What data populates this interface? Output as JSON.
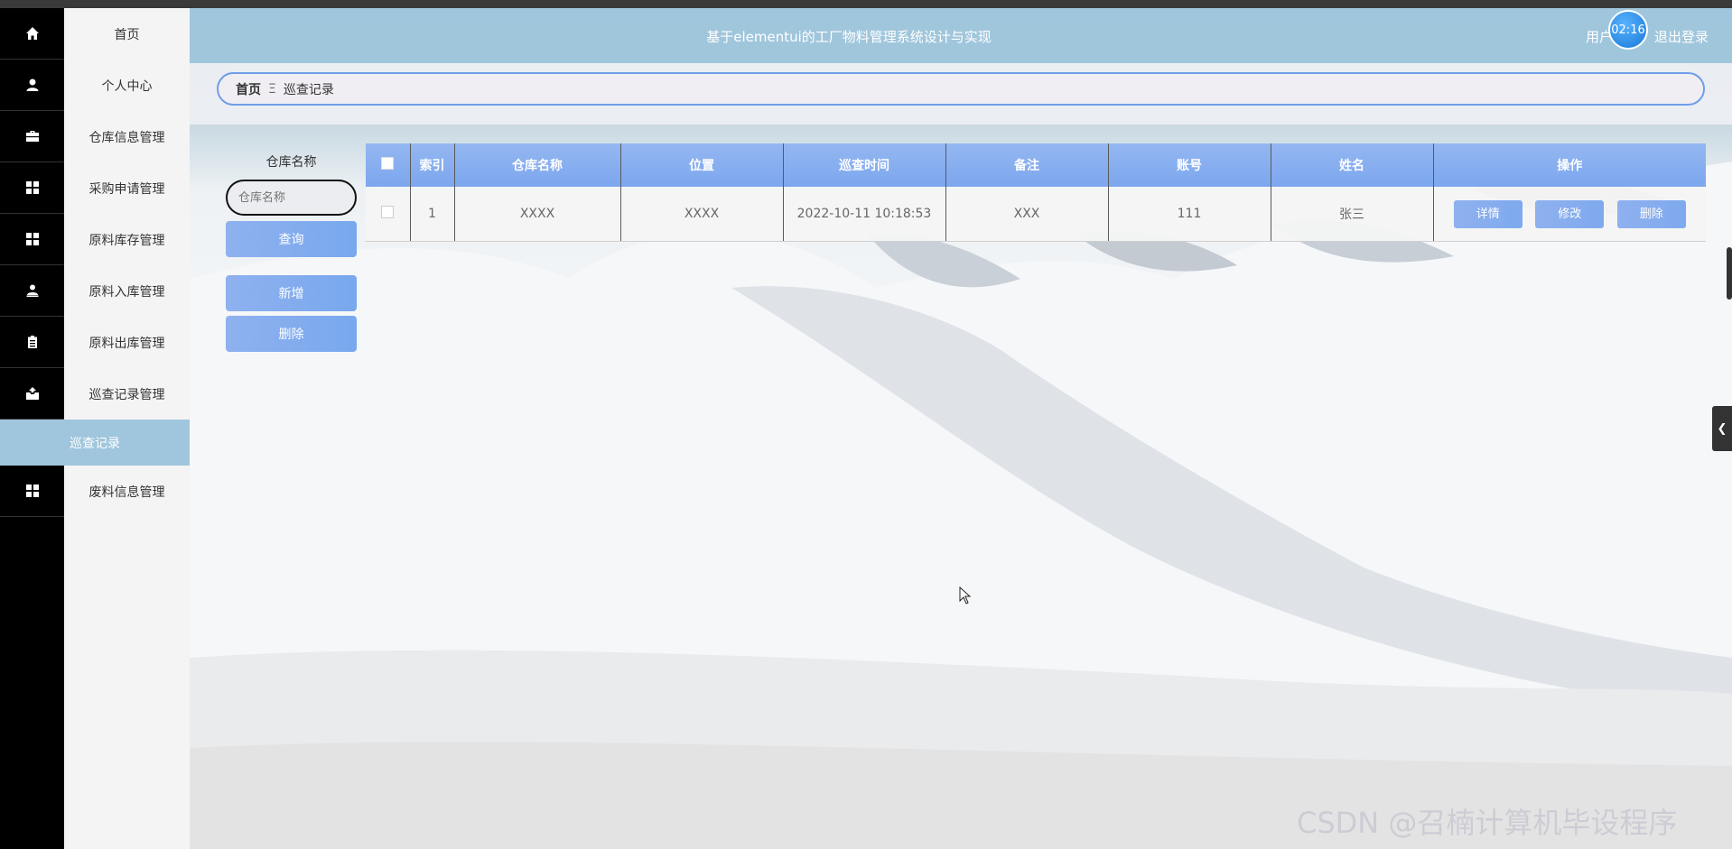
{
  "header": {
    "title": "基于elementui的工厂物料管理系统设计与实现",
    "user": "用户",
    "timer": "02:16",
    "logout": "退出登录"
  },
  "rail": {
    "icons": [
      "home-icon",
      "user-icon",
      "briefcase-icon",
      "grid-icon",
      "grid-icon",
      "person-icon",
      "clipboard-icon",
      "inbox-icon",
      "grid-icon"
    ]
  },
  "sidebar": {
    "items": [
      {
        "label": "首页"
      },
      {
        "label": "个人中心"
      },
      {
        "label": "仓库信息管理"
      },
      {
        "label": "采购申请管理"
      },
      {
        "label": "原料库存管理"
      },
      {
        "label": "原料入库管理"
      },
      {
        "label": "原料出库管理"
      },
      {
        "label": "巡查记录管理"
      },
      {
        "label": "废料信息管理"
      }
    ],
    "sub_active": "巡查记录"
  },
  "breadcrumb": {
    "home": "首页",
    "sep": "Ξ",
    "current": "巡查记录"
  },
  "search": {
    "label": "仓库名称",
    "placeholder": "仓库名称",
    "query_btn": "查询",
    "add_btn": "新增",
    "delete_btn": "删除"
  },
  "table": {
    "headers": [
      "索引",
      "仓库名称",
      "位置",
      "巡查时间",
      "备注",
      "账号",
      "姓名",
      "操作"
    ],
    "rows": [
      {
        "index": "1",
        "warehouse": "XXXX",
        "location": "XXXX",
        "time": "2022-10-11 10:18:53",
        "note": "XXX",
        "account": "111",
        "name": "张三"
      }
    ],
    "actions": {
      "detail": "详情",
      "edit": "修改",
      "delete": "删除"
    }
  },
  "watermark": "CSDN @召楠计算机毕设程序"
}
